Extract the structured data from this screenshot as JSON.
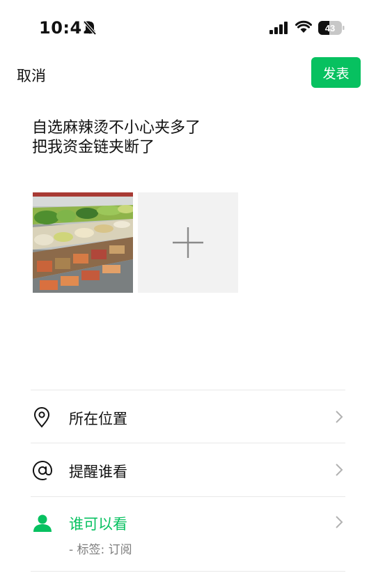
{
  "status_bar": {
    "time": "10:41",
    "battery_level": "43",
    "icons": [
      "bell-slash-icon",
      "signal-icon",
      "wifi-icon",
      "battery-icon"
    ]
  },
  "nav": {
    "cancel_label": "取消",
    "publish_label": "发表"
  },
  "post": {
    "lines": [
      "自选麻辣烫不小心夹多了",
      "把我资金链夹断了"
    ]
  },
  "options": {
    "location": {
      "label": "所在位置",
      "icon": "location-pin-icon"
    },
    "mention": {
      "label": "提醒谁看",
      "icon": "at-icon"
    },
    "visibility": {
      "label": "谁可以看",
      "sublabel": "- 标签: 订阅",
      "icon": "person-icon"
    }
  },
  "colors": {
    "accent": "#07c160",
    "divider": "#e8e8e8",
    "add_tile_bg": "#f2f2f2",
    "muted_text": "#7d7d7d"
  }
}
